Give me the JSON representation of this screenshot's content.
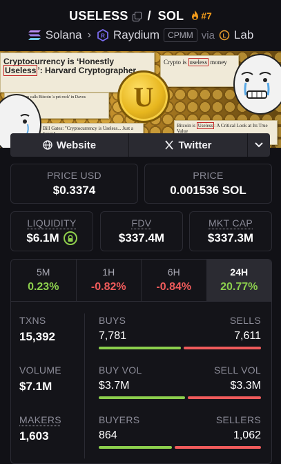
{
  "header": {
    "pair": "USELESS",
    "quote": "SOL",
    "slash": "/",
    "rank": "#7",
    "chain": "Solana",
    "dex": "Raydium",
    "pool_type": "CPMM",
    "via": "via",
    "launchpad": "Lab"
  },
  "banner": {
    "headline_prefix": "Cryptocurrency is ‘Honestly ",
    "headline_word": "Useless",
    "headline_suffix": "’: Harvard Cryptographer",
    "card2": "Jamie Dimon calls Bitcoin 'a pet rock' in Davos",
    "card3": "Bill Gates: \"Cryptocurrency is Useless... Just a Scam\"",
    "card4_a": "Crypto is ",
    "card4_word": "useless",
    "card4_b": " money",
    "card5_a": "Bitcoin is ",
    "card5_word": "Useless",
    "card5_b": ": A Critical Look at Its True Value",
    "coin_letter": "U"
  },
  "links": {
    "website": "Website",
    "twitter": "Twitter"
  },
  "stats": {
    "price_usd_label": "PRICE USD",
    "price_usd": "$0.3374",
    "price_label": "PRICE",
    "price_sol": "0.001536 SOL",
    "liquidity_label": "LIQUIDITY",
    "liquidity": "$6.1M",
    "fdv_label": "FDV",
    "fdv": "$337.4M",
    "mcap_label": "MKT CAP",
    "mcap": "$337.3M"
  },
  "timeframes": [
    {
      "label": "5M",
      "change": "0.23%",
      "dir": "pos"
    },
    {
      "label": "1H",
      "change": "-0.82%",
      "dir": "neg"
    },
    {
      "label": "6H",
      "change": "-0.84%",
      "dir": "neg"
    },
    {
      "label": "24H",
      "change": "20.77%",
      "dir": "pos"
    }
  ],
  "activity": {
    "txns_label": "TXNS",
    "txns": "15,392",
    "volume_label": "VOLUME",
    "volume": "$7.1M",
    "makers_label": "MAKERS",
    "makers": "1,603",
    "buys_label": "BUYS",
    "buys": "7,781",
    "sells_label": "SELLS",
    "sells": "7,611",
    "buy_vol_label": "BUY VOL",
    "buy_vol": "$3.7M",
    "sell_vol_label": "SELL VOL",
    "sell_vol": "$3.3M",
    "buyers_label": "BUYERS",
    "buyers": "864",
    "sellers_label": "SELLERS",
    "sellers": "1,062"
  },
  "ratios": {
    "buys_share": 0.505,
    "buy_vol_share": 0.53,
    "buyers_share": 0.45
  },
  "colors": {
    "positive": "#8ccf4d",
    "negative": "#f05b5b",
    "rank": "#f39c1b"
  }
}
